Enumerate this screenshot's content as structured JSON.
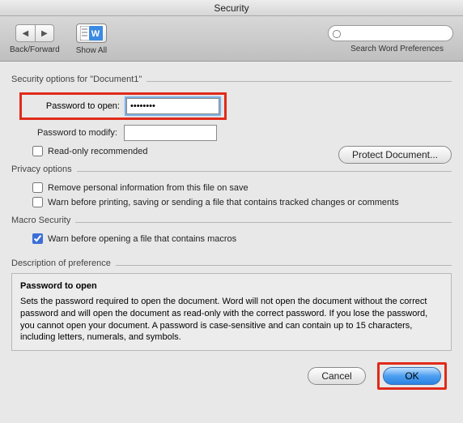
{
  "window": {
    "title": "Security"
  },
  "toolbar": {
    "back_forward_label": "Back/Forward",
    "showall_label": "Show All",
    "search_placeholder": "",
    "search_label": "Search Word Preferences"
  },
  "security": {
    "group_label": "Security options for \"Document1\"",
    "password_open_label": "Password to open:",
    "password_open_value": "••••••••",
    "password_modify_label": "Password to modify:",
    "password_modify_value": "",
    "readonly_label": "Read-only recommended",
    "readonly_checked": false,
    "protect_button": "Protect Document..."
  },
  "privacy": {
    "group_label": "Privacy options",
    "remove_personal_label": "Remove personal information from this file on save",
    "remove_personal_checked": false,
    "warn_print_label": "Warn before printing, saving or sending a file that contains tracked changes or comments",
    "warn_print_checked": false
  },
  "macro": {
    "group_label": "Macro Security",
    "warn_macro_label": "Warn before opening a file that contains macros",
    "warn_macro_checked": true
  },
  "description": {
    "group_label": "Description of preference",
    "title": "Password to open",
    "body": "Sets the password required to open the document. Word will not open the document without the correct password and will open the document as read-only with the correct password. If you lose the password, you cannot open your document. A password is case-sensitive and can contain up to 15 characters, including letters, numerals, and symbols."
  },
  "buttons": {
    "cancel": "Cancel",
    "ok": "OK"
  }
}
